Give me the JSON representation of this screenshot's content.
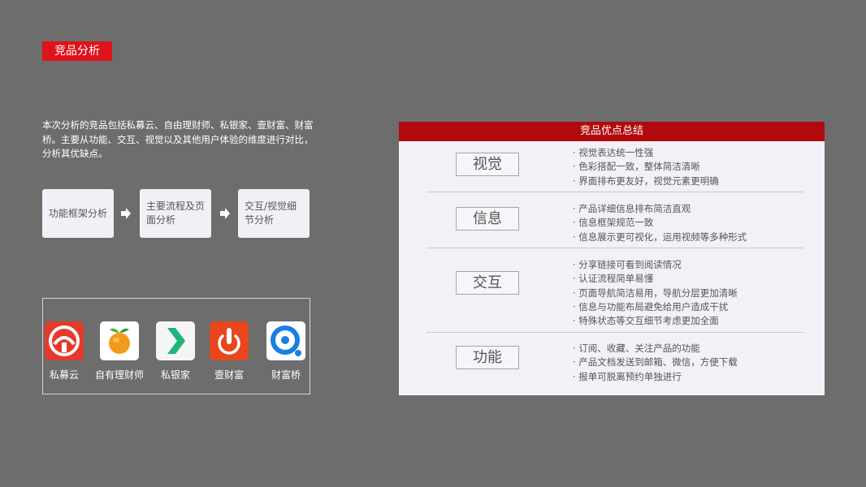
{
  "title": "竞品分析",
  "intro": "本次分析的竞品包括私募云、自由理财师、私银家、壹财富、财富桥。主要从功能、交互、视觉以及其他用户体验的维度进行对比，分析其优缺点。",
  "steps": [
    {
      "label": "功能框架分析"
    },
    {
      "label": "主要流程及页面分析"
    },
    {
      "label": "交互/视觉细节分析"
    }
  ],
  "apps": [
    {
      "name": "私募云",
      "icon": "simuyun-logo-icon",
      "color": "#e33a2c"
    },
    {
      "name": "自有理财师",
      "icon": "orange-fruit-icon",
      "color": "#f39a1a"
    },
    {
      "name": "私银家",
      "icon": "green-chevron-icon",
      "color": "#1bb678"
    },
    {
      "name": "壹财富",
      "icon": "power-hand-icon",
      "color": "#e8471d"
    },
    {
      "name": "财富桥",
      "icon": "q-logo-icon",
      "color": "#1a7fe3"
    }
  ],
  "panel": {
    "title": "竞品优点总结",
    "sections": [
      {
        "label": "视觉",
        "bullets": [
          "· 视觉表达统一性强",
          "· 色彩搭配一致，整体简洁清晰",
          "· 界面排布更友好，视觉元素更明确"
        ]
      },
      {
        "label": "信息",
        "bullets": [
          "· 产品详细信息排布简洁直观",
          "· 信息框架规范一致",
          "· 信息展示更可视化，运用视频等多种形式"
        ]
      },
      {
        "label": "交互",
        "bullets": [
          "· 分享链接可看到阅读情况",
          "· 认证流程简单易懂",
          "· 页面导航简洁易用，导航分层更加清晰",
          "· 信息与功能布局避免给用户造成干扰",
          "· 特殊状态等交互细节考虑更加全面"
        ]
      },
      {
        "label": "功能",
        "bullets": [
          "· 订阅、收藏、关注产品的功能",
          "· 产品文档发送到邮箱、微信，方便下载",
          "· 报单可脱离预约单独进行"
        ]
      }
    ]
  }
}
